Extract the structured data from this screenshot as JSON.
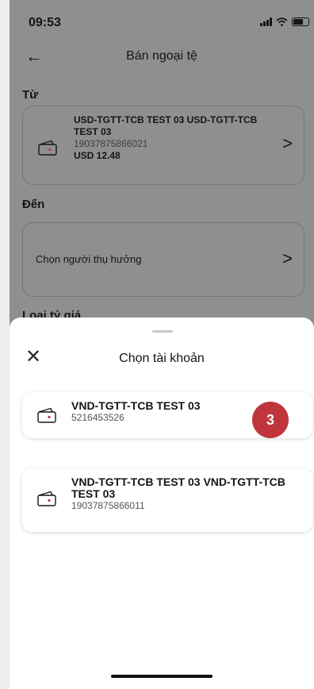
{
  "status_bar": {
    "time": "09:53"
  },
  "header": {
    "title": "Bán ngoại tệ"
  },
  "from": {
    "label": "Từ",
    "account_name": "USD-TGTT-TCB TEST 03 USD-TGTT-TCB TEST 03",
    "account_number": "19037875866021",
    "balance": "USD 12.48"
  },
  "to": {
    "label": "Đến",
    "placeholder": "Chọn người thụ hưởng"
  },
  "partial_label": "Loại tỷ giá",
  "sheet": {
    "title": "Chọn tài khoản",
    "accounts": [
      {
        "name": "VND-TGTT-TCB TEST 03",
        "number": "5216453526"
      },
      {
        "name": "VND-TGTT-TCB TEST 03 VND-TGTT-TCB TEST 03",
        "number": "19037875866011"
      }
    ]
  },
  "step_badge": "3",
  "colors": {
    "accent": "#c0353c",
    "overlay": "#8f8f8f"
  }
}
